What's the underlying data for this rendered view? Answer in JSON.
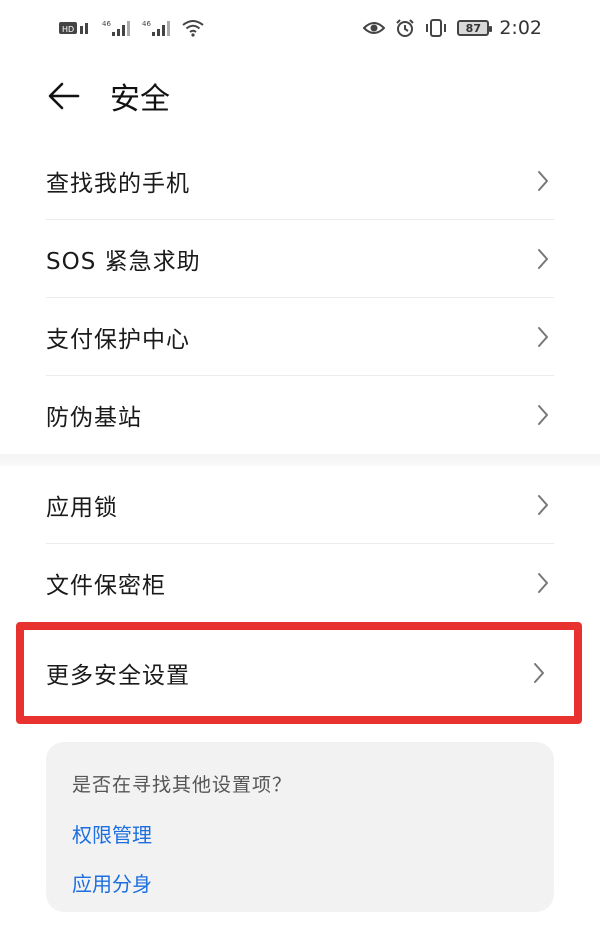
{
  "status_bar": {
    "sim_labels": [
      "HD",
      "46",
      "46"
    ],
    "battery": "87",
    "time": "2:02"
  },
  "header": {
    "title": "安全"
  },
  "group1": {
    "items": [
      {
        "label": "查找我的手机"
      },
      {
        "label": "SOS 紧急求助"
      },
      {
        "label": "支付保护中心"
      },
      {
        "label": "防伪基站"
      }
    ]
  },
  "group2": {
    "items": [
      {
        "label": "应用锁"
      },
      {
        "label": "文件保密柜"
      }
    ]
  },
  "highlighted_item": {
    "label": "更多安全设置",
    "highlight_color": "#e8322f"
  },
  "suggestions": {
    "question": "是否在寻找其他设置项？",
    "links": [
      "权限管理",
      "应用分身"
    ],
    "link_color": "#1d6fe0"
  }
}
